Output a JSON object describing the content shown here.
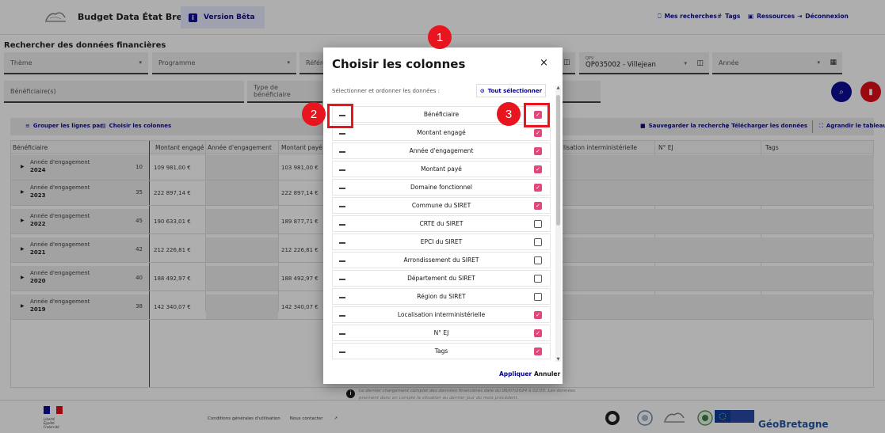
{
  "header": {
    "app_title": "Budget Data État Bretagne",
    "beta_label": "Version Bêta",
    "nav": [
      {
        "label": "Mes recherches",
        "icon": "bookmark-icon"
      },
      {
        "label": "Tags",
        "icon": "hash-icon"
      },
      {
        "label": "Ressources",
        "icon": "book-icon"
      },
      {
        "label": "Déconnexion",
        "icon": "logout-icon"
      }
    ]
  },
  "search": {
    "title": "Rechercher des données financières",
    "filters": {
      "theme": "Thème",
      "programme": "Programme",
      "referentiel": "Référe",
      "qpv_label": "QPV",
      "qpv_value": "QP035002 - Villejean",
      "annee": "Année",
      "beneficiaires": "Bénéficiaire(s)",
      "type_beneficiaire": "Type de bénéficiaire"
    }
  },
  "toolbar": {
    "group_by": "Grouper les lignes par",
    "choose_columns": "Choisir les colonnes",
    "save_search": "Sauvegarder la recherche",
    "download": "Télécharger les données",
    "expand": "Agrandir le tableau"
  },
  "table": {
    "headers": [
      "Bénéficiaire",
      "Montant engagé",
      "Année d'engagement",
      "Montant payé",
      "lisation interministérielle",
      "N° EJ",
      "Tags"
    ],
    "groups": [
      {
        "label": "Année d'engagement",
        "year": "2024",
        "count": "10",
        "engage": "109 981,00 €",
        "paye": "103 981,00 €"
      },
      {
        "label": "Année d'engagement",
        "year": "2023",
        "count": "35",
        "engage": "222 897,14 €",
        "paye": "222 897,14 €"
      },
      {
        "label": "Année d'engagement",
        "year": "2022",
        "count": "45",
        "engage": "190 633,01 €",
        "paye": "189 877,71 €"
      },
      {
        "label": "Année d'engagement",
        "year": "2021",
        "count": "42",
        "engage": "212 226,81 €",
        "paye": "212 226,81 €"
      },
      {
        "label": "Année d'engagement",
        "year": "2020",
        "count": "40",
        "engage": "188 492,97 €",
        "paye": "188 492,97 €"
      },
      {
        "label": "Année d'engagement",
        "year": "2019",
        "count": "38",
        "engage": "142 340,07 €",
        "paye": "142 340,07 €"
      }
    ]
  },
  "notice": "Le dernier chargement complet des données financières date du 06/07/2024 à 02:05. Les données prennent donc en compte la situation au dernier jour du mois précédent.",
  "footer": {
    "motto": [
      "Liberté",
      "Égalité",
      "Fraternité"
    ],
    "links": [
      "Conditions générales d'utilisation",
      "Nous contacter"
    ],
    "eu_text": "Financé par l'Union européenne",
    "geo": "GéoBretagne"
  },
  "modal": {
    "title": "Choisir les colonnes",
    "close": "×",
    "subtitle": "Sélectionner et ordonner les données :",
    "select_all": "Tout sélectionner",
    "apply": "Appliquer",
    "cancel": "Annuler",
    "columns": [
      {
        "label": "Bénéficiaire",
        "checked": true
      },
      {
        "label": "Montant engagé",
        "checked": true
      },
      {
        "label": "Année d'engagement",
        "checked": true
      },
      {
        "label": "Montant payé",
        "checked": true
      },
      {
        "label": "Domaine fonctionnel",
        "checked": true
      },
      {
        "label": "Commune du SIRET",
        "checked": true
      },
      {
        "label": "CRTE du SIRET",
        "checked": false
      },
      {
        "label": "EPCI du SIRET",
        "checked": false
      },
      {
        "label": "Arrondissement du SIRET",
        "checked": false
      },
      {
        "label": "Département du SIRET",
        "checked": false
      },
      {
        "label": "Région du SIRET",
        "checked": false
      },
      {
        "label": "Localisation interministérielle",
        "checked": true
      },
      {
        "label": "N° EJ",
        "checked": true
      },
      {
        "label": "Tags",
        "checked": true
      }
    ]
  },
  "annotations": [
    "1",
    "2",
    "3"
  ],
  "colors": {
    "primary": "#000091",
    "accent": "#e1467c",
    "danger": "#e1000f",
    "annotation": "#e8141e"
  }
}
